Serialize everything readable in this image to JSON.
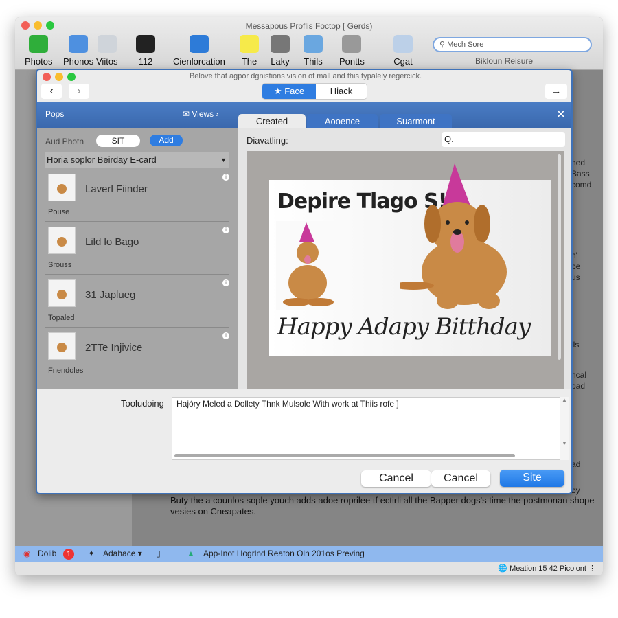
{
  "window": {
    "title": "Messapous Proflis Foctop [ Gerds)"
  },
  "toolbar": {
    "items": [
      {
        "label": "Photos",
        "color": "#2fae3a"
      },
      {
        "label": "Phonos",
        "color": "#4e90e0"
      },
      {
        "label": "Viitos",
        "color": "#cfd4da"
      },
      {
        "label": "112",
        "color": "#222222"
      },
      {
        "label": "Cienlorcation",
        "color": "#2d7bd8"
      },
      {
        "label": "The",
        "color": "#f6ea4a"
      },
      {
        "label": "Laky",
        "color": "#777777"
      },
      {
        "label": "Thils",
        "color": "#6aa7e0"
      },
      {
        "label": "Pontts",
        "color": "#999999"
      },
      {
        "label": "Cgat",
        "color": "#bcd0e8"
      }
    ],
    "search_placeholder": "Mech Sore",
    "search_caption": "Bikloun Reisure"
  },
  "dialog": {
    "subtitle": "Belove that agpor dgnistions vision of mall and this typalely regercick.",
    "seg": [
      "Face",
      "Hiack"
    ],
    "header_left": "Pops",
    "views": "Views",
    "tabs": [
      "Created",
      "Aooence",
      "Suarmont"
    ],
    "left": {
      "add_label": "Aud Photn",
      "toggle": "SIT",
      "add_button": "Add",
      "dropdown": "Horia soplor Beirday E-card",
      "items": [
        {
          "title": "Laverl Fiinder",
          "sub": "Pouse"
        },
        {
          "title": "Lild lo Bago",
          "sub": "Srouss"
        },
        {
          "title": "31 Japlueg",
          "sub": "Topaled"
        },
        {
          "title": "2TTe Injivice",
          "sub": "Fnendoles"
        }
      ]
    },
    "right": {
      "label": "Diavatling:",
      "search_value": "Q.",
      "card_title": "Depire Tlago S!",
      "card_greeting": "Happy Adapy Bitthday"
    },
    "message_label": "Tooludoing",
    "message_value": "Hajóry Meled a Dollety Thnk Mulsole With work at Thiis rofe ]",
    "buttons": [
      "Cancel",
      "Cancel",
      "Site"
    ]
  },
  "background_text": {
    "right_fragments": [
      "hed",
      "Bass",
      "comd",
      "n'",
      "pe",
      "us",
      "jls",
      "hcal",
      "oad",
      "ad",
      "by"
    ],
    "paragraph": "Buty the a counlos sople youch adds adoe roprilee tf ectirli all the Bapper dogs's time the postmonan shope vesies on Cneapates."
  },
  "statusbar": {
    "item1": "Dolib",
    "badge": "1",
    "item2": "Adahace",
    "message": "App-Inot Hogrlnd Reaton Oln 201os Preving"
  },
  "footer": {
    "text": "Meation 15 42 Picolont"
  },
  "colors": {
    "accent": "#2f7de1",
    "header": "#3f72b8"
  }
}
